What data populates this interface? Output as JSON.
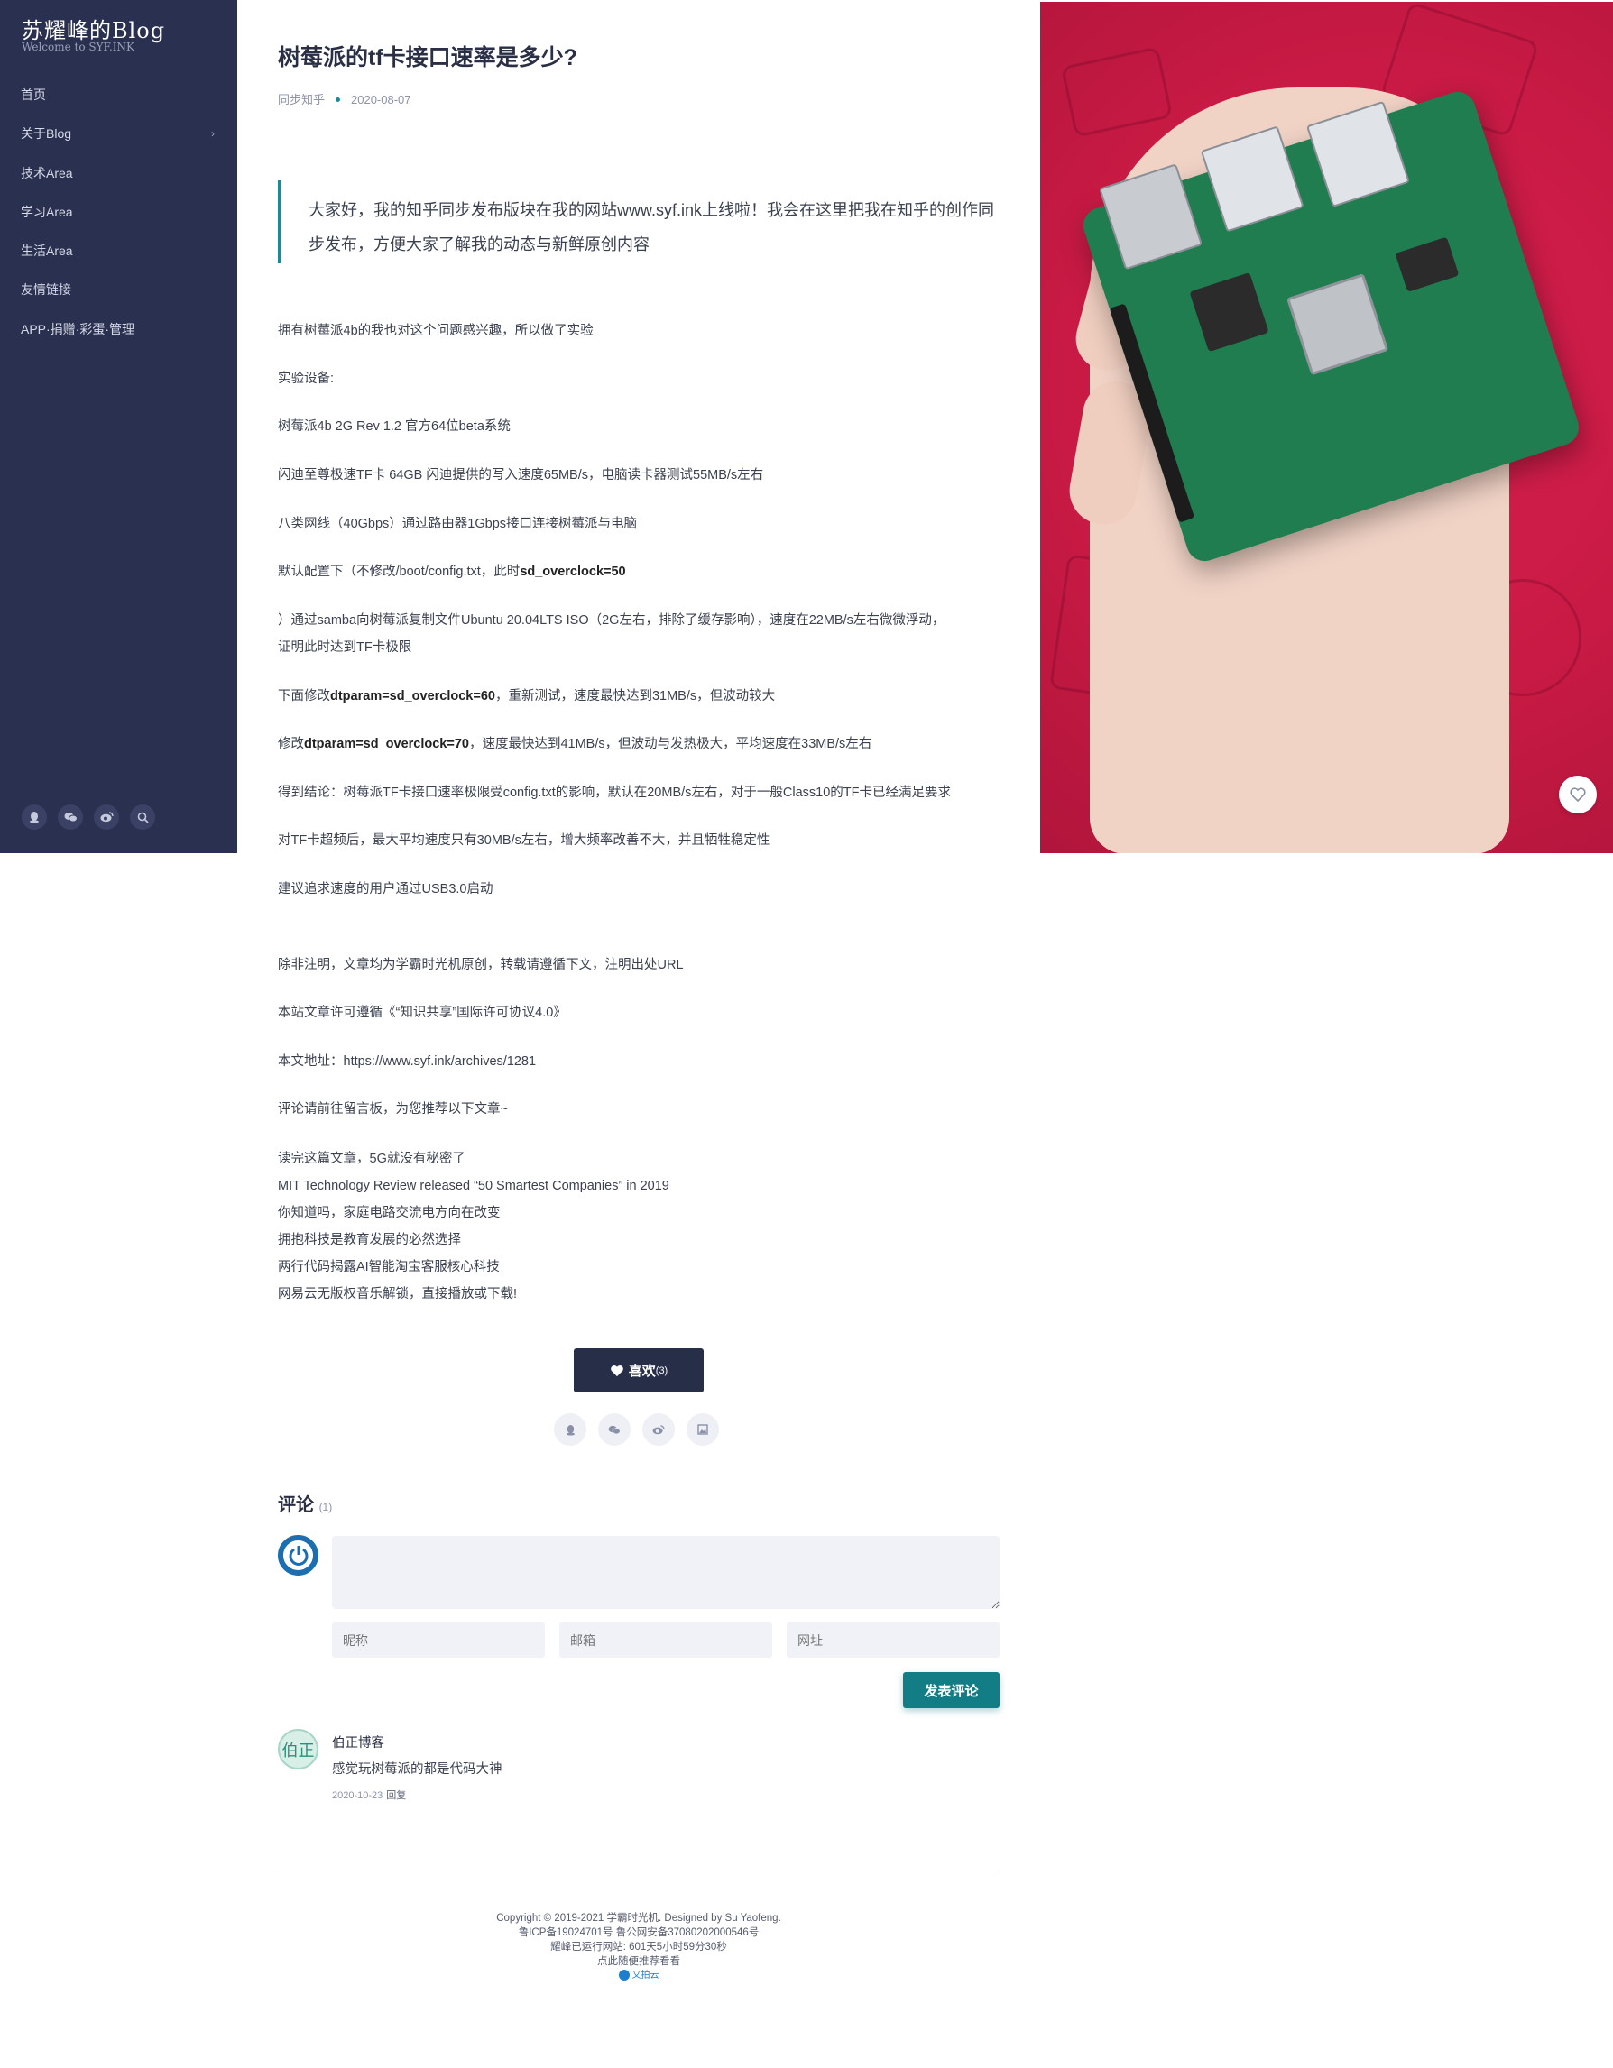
{
  "sidebar": {
    "brand_title": "苏耀峰的Blog",
    "brand_sub": "Welcome to SYF.INK",
    "items": [
      {
        "label": "首页"
      },
      {
        "label": "关于Blog",
        "chevron": "›"
      },
      {
        "label": "技术Area"
      },
      {
        "label": "学习Area"
      },
      {
        "label": "生活Area"
      },
      {
        "label": "友情链接"
      },
      {
        "label": "APP·捐赠·彩蛋·管理"
      }
    ],
    "icons": [
      "qq-icon",
      "wechat-icon",
      "weibo-icon",
      "search-icon"
    ]
  },
  "article": {
    "title": "树莓派的tf卡接口速率是多少?",
    "category": "同步知乎",
    "date": "2020-08-07",
    "quote": "大家好，我的知乎同步发布版块在我的网站www.syf.ink上线啦！我会在这里把我在知乎的创作同步发布，方便大家了解我的动态与新鲜原创内容",
    "p1": "拥有树莓派4b的我也对这个问题感兴趣，所以做了实验",
    "p2": "实验设备:",
    "p3": "树莓派4b 2G Rev 1.2 官方64位beta系统",
    "p4": "闪迪至尊极速TF卡 64GB 闪迪提供的写入速度65MB/s，电脑读卡器测试55MB/s左右",
    "p5": "八类网线（40Gbps）通过路由器1Gbps接口连接树莓派与电脑",
    "p6_pre": "默认配置下（不修改/boot/config.txt，此时",
    "p6_bold": "sd_overclock=50",
    "p7a": "）通过samba向树莓派复制文件Ubuntu 20.04LTS ISO（2G左右，排除了缓存影响），速度在22MB/s左右微微浮动，",
    "p7b": "证明此时达到TF卡极限",
    "p8_pre": "下面修改",
    "p8_bold": "dtparam=sd_overclock=60",
    "p8_post": "，重新测试，速度最快达到31MB/s，但波动较大",
    "p9_pre": "修改",
    "p9_bold": "dtparam=sd_overclock=70",
    "p9_post": "，速度最快达到41MB/s，但波动与发热极大，平均速度在33MB/s左右",
    "p10": "得到结论：树莓派TF卡接口速率极限受config.txt的影响，默认在20MB/s左右，对于一般Class10的TF卡已经满足要求",
    "p11": "对TF卡超频后，最大平均速度只有30MB/s左右，增大频率改善不大，并且牺牲稳定性",
    "p12": "建议追求速度的用户通过USB3.0启动",
    "n1": "除非注明，文章均为学霸时光机原创，转载请遵循下文，注明出处URL",
    "n2": "本站文章许可遵循《“知识共享”国际许可协议4.0》",
    "n3": "本文地址：https://www.syf.ink/archives/1281",
    "n4": "评论请前往留言板，为您推荐以下文章~",
    "recommended": [
      "读完这篇文章，5G就没有秘密了",
      "MIT Technology Review released “50 Smartest Companies” in 2019",
      "你知道吗，家庭电路交流电方向在改变",
      "拥抱科技是教育发展的必然选择",
      "两行代码揭露AI智能淘宝客服核心科技",
      "网易云无版权音乐解锁，直接播放或下载!"
    ]
  },
  "like": {
    "label": "喜欢",
    "count": "(3)"
  },
  "share_icons": [
    "qq-icon",
    "wechat-icon",
    "weibo-icon",
    "image-icon"
  ],
  "comments": {
    "title": "评论",
    "count": "(1)",
    "name_placeholder": "昵称",
    "email_placeholder": "邮箱",
    "url_placeholder": "网址",
    "submit": "发表评论",
    "items": [
      {
        "author": "伯正博客",
        "avatar_text": "伯正",
        "body": "感觉玩树莓派的都是代码大神",
        "date": "2020-10-23",
        "reply": "回复"
      }
    ]
  },
  "footer": {
    "line1": "Copyright © 2019-2021 学霸时光机. Designed by Su Yaofeng.",
    "line2": "鲁ICP备19024701号 鲁公网安备37080202000546号",
    "line3": "耀峰已运行网站: 601天5小时59分30秒",
    "line4": "点此随便推荐看看",
    "line5": "又拍云"
  },
  "colors": {
    "sidebar": "#2a3050",
    "accent": "#1a8a95",
    "hero": "#c81a44",
    "button_dark": "#272e48"
  }
}
